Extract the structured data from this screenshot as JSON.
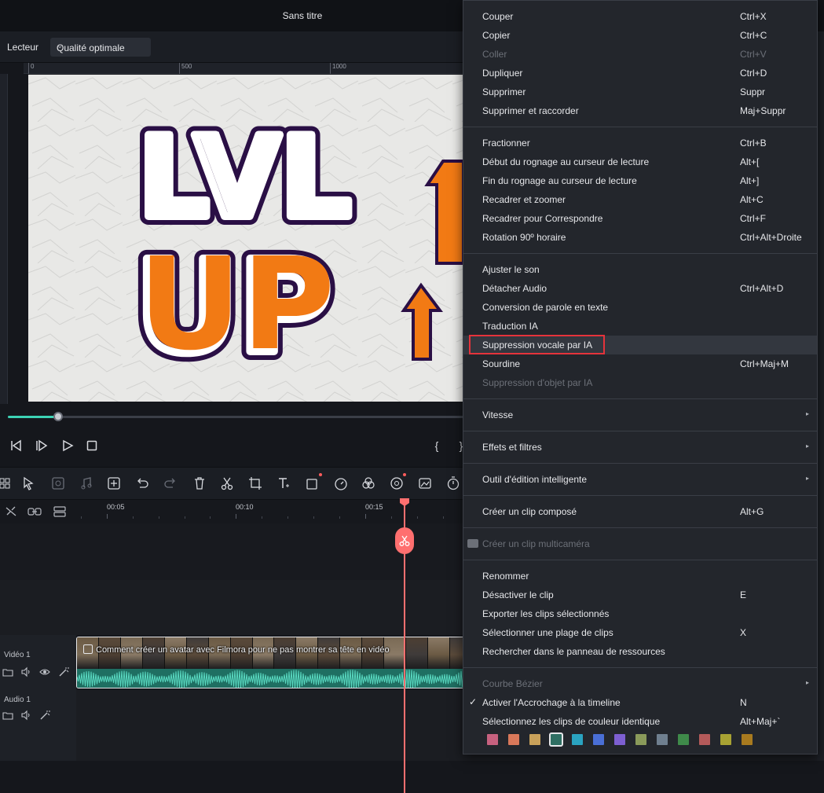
{
  "window": {
    "title": "Sans titre"
  },
  "player": {
    "label": "Lecteur",
    "quality": "Qualité optimale",
    "ruler_ticks": [
      "0",
      "500",
      "1000"
    ],
    "progress": 0.11
  },
  "timeline": {
    "time_labels": [
      "00:05",
      "00:10",
      "00:15"
    ],
    "video_track_name": "Vidéo 1",
    "audio_track_name": "Audio 1",
    "clip_title": "Comment créer un avatar avec Filmora pour ne pas montrer sa tête en vidéo"
  },
  "menu": {
    "groups": [
      [
        {
          "label": "Couper",
          "shortcut": "Ctrl+X"
        },
        {
          "label": "Copier",
          "shortcut": "Ctrl+C"
        },
        {
          "label": "Coller",
          "shortcut": "Ctrl+V",
          "disabled": true
        },
        {
          "label": "Dupliquer",
          "shortcut": "Ctrl+D"
        },
        {
          "label": "Supprimer",
          "shortcut": "Suppr"
        },
        {
          "label": "Supprimer et raccorder",
          "shortcut": "Maj+Suppr"
        }
      ],
      [
        {
          "label": "Fractionner",
          "shortcut": "Ctrl+B"
        },
        {
          "label": "Début du rognage au curseur de lecture",
          "shortcut": "Alt+["
        },
        {
          "label": "Fin du rognage au curseur de lecture",
          "shortcut": "Alt+]"
        },
        {
          "label": "Recadrer et zoomer",
          "shortcut": "Alt+C"
        },
        {
          "label": "Recadrer pour Correspondre",
          "shortcut": "Ctrl+F"
        },
        {
          "label": "Rotation 90º horaire",
          "shortcut": "Ctrl+Alt+Droite"
        }
      ],
      [
        {
          "label": "Ajuster le son",
          "shortcut": ""
        },
        {
          "label": "Détacher Audio",
          "shortcut": "Ctrl+Alt+D"
        },
        {
          "label": "Conversion de parole en texte",
          "shortcut": ""
        },
        {
          "label": "Traduction IA",
          "shortcut": ""
        },
        {
          "label": "Suppression vocale par IA",
          "shortcut": "",
          "highlighted": true
        },
        {
          "label": "Sourdine",
          "shortcut": "Ctrl+Maj+M"
        },
        {
          "label": "Suppression d'objet par IA",
          "shortcut": "",
          "disabled": true
        }
      ],
      [
        {
          "label": "Vitesse",
          "shortcut": "",
          "submenu": true
        }
      ],
      [
        {
          "label": "Effets et filtres",
          "shortcut": "",
          "submenu": true
        }
      ],
      [
        {
          "label": "Outil d'édition intelligente",
          "shortcut": "",
          "submenu": true
        }
      ],
      [
        {
          "label": "Créer un clip composé",
          "shortcut": "Alt+G"
        }
      ],
      [
        {
          "label": "Créer un clip multicaméra",
          "shortcut": "",
          "disabled": true,
          "icon": "camera-icon"
        }
      ],
      [
        {
          "label": "Renommer",
          "shortcut": ""
        },
        {
          "label": "Désactiver le clip",
          "shortcut": "E"
        },
        {
          "label": "Exporter les clips sélectionnés",
          "shortcut": ""
        },
        {
          "label": "Sélectionner une plage de clips",
          "shortcut": "X"
        },
        {
          "label": "Rechercher dans le panneau de ressources",
          "shortcut": ""
        }
      ],
      [
        {
          "label": "Courbe Bézier",
          "shortcut": "",
          "disabled": true,
          "submenu": true
        },
        {
          "label": "Activer l'Accrochage à la timeline",
          "shortcut": "N",
          "checked": true
        },
        {
          "label": "Sélectionnez les clips de couleur identique",
          "shortcut": "Alt+Maj+`"
        }
      ]
    ],
    "swatches": [
      "#c7617f",
      "#d9785a",
      "#c9a15a",
      "#2f6f63",
      "#2aa3c0",
      "#4a6fd6",
      "#7d5fd1",
      "#8a9a5a",
      "#6f7f8f",
      "#3f8a4a",
      "#b45a5a",
      "#a8a233",
      "#a87a1f"
    ],
    "selected_swatch": 3
  },
  "colors": {
    "accent": "#3cd3b5",
    "playhead": "#ff6f6f",
    "highlight_border": "#e5333b"
  }
}
